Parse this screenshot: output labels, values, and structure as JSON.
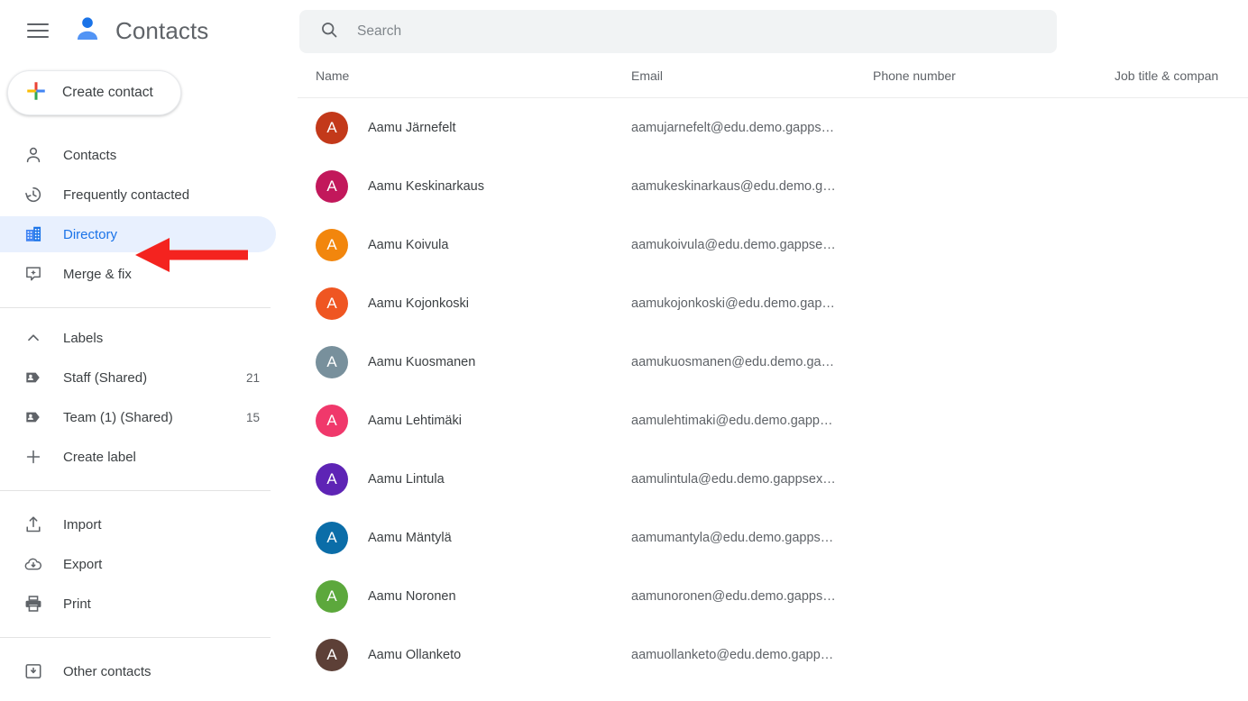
{
  "app": {
    "title": "Contacts",
    "menu_icon": "hamburger-menu-icon",
    "logo_icon": "contacts-person-logo-icon"
  },
  "sidebar": {
    "create_contact": {
      "label": "Create contact",
      "icon": "plus-multicolor-icon"
    },
    "nav": [
      {
        "label": "Contacts",
        "icon": "person-outline-icon",
        "selected": false
      },
      {
        "label": "Frequently contacted",
        "icon": "history-clock-icon",
        "selected": false
      },
      {
        "label": "Directory",
        "icon": "building-directory-icon",
        "selected": true
      },
      {
        "label": "Merge & fix",
        "icon": "merge-sparkle-icon",
        "selected": false
      }
    ],
    "labels_section": {
      "header": "Labels",
      "collapse_icon": "chevron-up-icon",
      "items": [
        {
          "label": "Staff (Shared)",
          "count": "21",
          "icon": "label-tag-icon"
        },
        {
          "label": "Team (1) (Shared)",
          "count": "15",
          "icon": "label-tag-icon"
        }
      ],
      "create_label": {
        "label": "Create label",
        "icon": "plus-icon"
      }
    },
    "tools": [
      {
        "label": "Import",
        "icon": "upload-import-icon"
      },
      {
        "label": "Export",
        "icon": "cloud-download-export-icon"
      },
      {
        "label": "Print",
        "icon": "printer-icon"
      }
    ],
    "other": [
      {
        "label": "Other contacts",
        "icon": "archive-box-icon"
      }
    ]
  },
  "search": {
    "placeholder": "Search",
    "value": "",
    "icon": "search-magnifier-icon"
  },
  "table": {
    "columns": [
      "Name",
      "Email",
      "Phone number",
      "Job title & compan"
    ],
    "rows": [
      {
        "initial": "A",
        "avatar_color": "#C3391A",
        "name": "Aamu Järnefelt",
        "email": "aamujarnefelt@edu.demo.gapps…",
        "phone": "",
        "job": ""
      },
      {
        "initial": "A",
        "avatar_color": "#C2185B",
        "name": "Aamu Keskinarkaus",
        "email": "aamukeskinarkaus@edu.demo.g…",
        "phone": "",
        "job": ""
      },
      {
        "initial": "A",
        "avatar_color": "#F2860D",
        "name": "Aamu Koivula",
        "email": "aamukoivula@edu.demo.gappse…",
        "phone": "",
        "job": ""
      },
      {
        "initial": "A",
        "avatar_color": "#EF5622",
        "name": "Aamu Kojonkoski",
        "email": "aamukojonkoski@edu.demo.gap…",
        "phone": "",
        "job": ""
      },
      {
        "initial": "A",
        "avatar_color": "#78909C",
        "name": "Aamu Kuosmanen",
        "email": "aamukuosmanen@edu.demo.ga…",
        "phone": "",
        "job": ""
      },
      {
        "initial": "A",
        "avatar_color": "#F0386B",
        "name": "Aamu Lehtimäki",
        "email": "aamulehtimaki@edu.demo.gapp…",
        "phone": "",
        "job": ""
      },
      {
        "initial": "A",
        "avatar_color": "#5E24B5",
        "name": "Aamu Lintula",
        "email": "aamulintula@edu.demo.gappsex…",
        "phone": "",
        "job": ""
      },
      {
        "initial": "A",
        "avatar_color": "#0B6DA8",
        "name": "Aamu Mäntylä",
        "email": "aamumantyla@edu.demo.gapps…",
        "phone": "",
        "job": ""
      },
      {
        "initial": "A",
        "avatar_color": "#5CA83C",
        "name": "Aamu Noronen",
        "email": "aamunoronen@edu.demo.gapps…",
        "phone": "",
        "job": ""
      },
      {
        "initial": "A",
        "avatar_color": "#5D4037",
        "name": "Aamu Ollanketo",
        "email": "aamuollanketo@edu.demo.gapp…",
        "phone": "",
        "job": ""
      }
    ]
  },
  "annotation": {
    "arrow_color": "#F4231F",
    "points_to": "Directory"
  },
  "colors": {
    "accent_blue": "#1a73e8",
    "selected_bg": "#e8f0fe",
    "search_bg": "#f1f3f4",
    "text_primary": "#3c4043",
    "text_secondary": "#5f6368"
  }
}
